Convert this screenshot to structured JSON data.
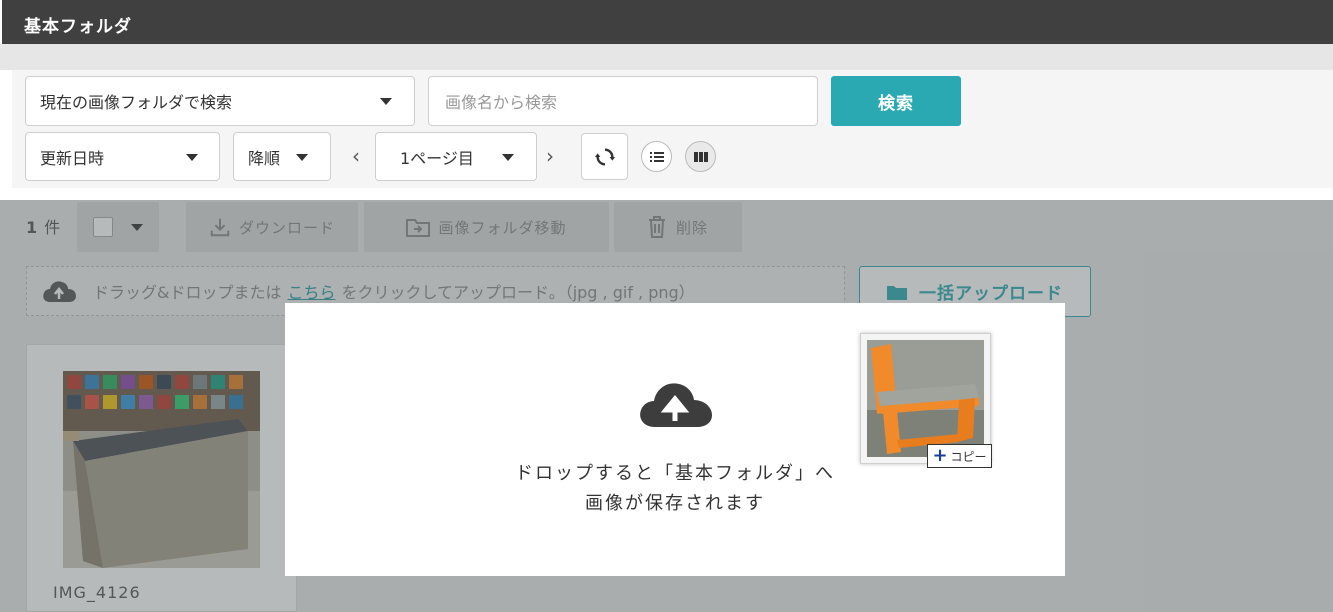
{
  "header": {
    "title": "基本フォルダ"
  },
  "search": {
    "scope_select": "現在の画像フォルダで検索",
    "name_placeholder": "画像名から検索",
    "search_button": "検索"
  },
  "sort": {
    "field_select": "更新日時",
    "order_select": "降順",
    "page_select": "1ページ目"
  },
  "toolbar": {
    "count_value": "1",
    "count_unit": "件",
    "download_label": "ダウンロード",
    "move_label": "画像フォルダ移動",
    "delete_label": "削除"
  },
  "upload": {
    "text_before": "ドラッグ&ドロップまたは",
    "link_text": "こちら",
    "text_after": "をクリックしてアップロード。（jpg , gif , png）",
    "bulk_button": "一括アップロード"
  },
  "images": [
    {
      "name": "IMG_4126"
    }
  ],
  "drop_modal": {
    "line1": "ドロップすると「基本フォルダ」へ",
    "line2": "画像が保存されます"
  },
  "drag": {
    "copy_label": "コピー"
  },
  "colors": {
    "accent": "#2ba9b3",
    "titlebar": "#404040",
    "chair_orange": "#f08a2a"
  },
  "icons": [
    "cloud-upload-icon",
    "download-icon",
    "folder-move-icon",
    "trash-icon",
    "refresh-icon",
    "list-view-icon",
    "grid-view-icon",
    "chevron-left-icon",
    "chevron-right-icon",
    "folder-icon"
  ]
}
